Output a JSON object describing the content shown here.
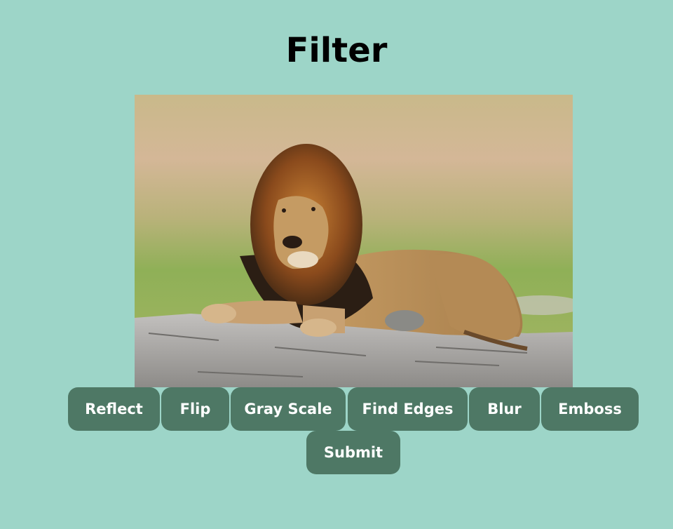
{
  "page": {
    "title": "Filter"
  },
  "image": {
    "description_icon": "lion-photo"
  },
  "filters": {
    "reflect": "Reflect",
    "flip": "Flip",
    "gray_scale": "Gray Scale",
    "find_edges": "Find Edges",
    "blur": "Blur",
    "emboss": "Emboss"
  },
  "actions": {
    "submit": "Submit"
  },
  "colors": {
    "background": "#9dd5c8",
    "button": "#4e7865",
    "button_text": "#ffffff"
  }
}
